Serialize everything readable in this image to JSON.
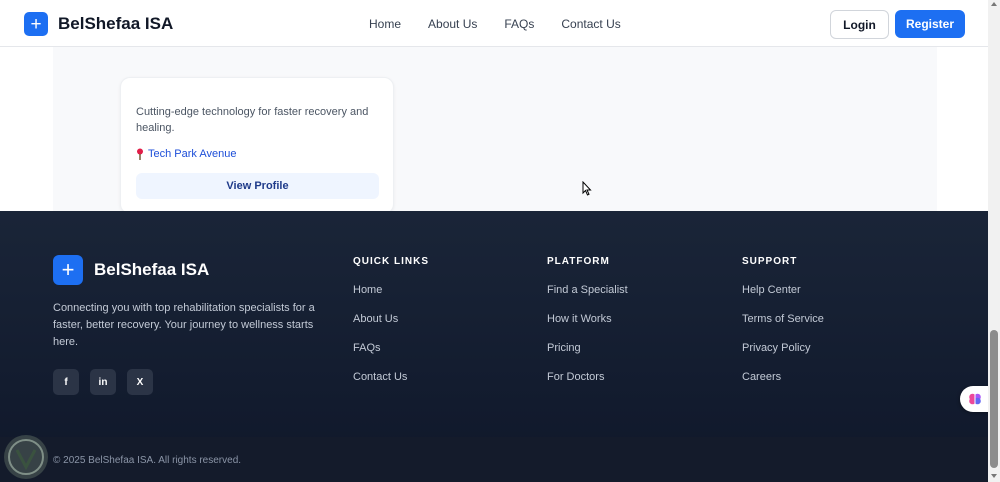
{
  "header": {
    "brand": "BelShefaa ISA",
    "logo_glyph": "+",
    "nav": [
      "Home",
      "About Us",
      "FAQs",
      "Contact Us"
    ],
    "login_label": "Login",
    "register_label": "Register"
  },
  "card": {
    "description": "Cutting-edge technology for faster recovery and healing.",
    "location": "Tech Park Avenue",
    "location_icon": "map-pin-icon",
    "button_label": "View Profile"
  },
  "footer": {
    "brand": "BelShefaa ISA",
    "logo_glyph": "+",
    "tagline": "Connecting you with top rehabilitation specialists for a faster, better recovery. Your journey to wellness starts here.",
    "socials": [
      {
        "label": "f",
        "icon": "facebook-icon"
      },
      {
        "label": "in",
        "icon": "linkedin-icon"
      },
      {
        "label": "X",
        "icon": "x-icon"
      }
    ],
    "columns": [
      {
        "title": "QUICK LINKS",
        "links": [
          "Home",
          "About Us",
          "FAQs",
          "Contact Us"
        ]
      },
      {
        "title": "PLATFORM",
        "links": [
          "Find a Specialist",
          "How it Works",
          "Pricing",
          "For Doctors"
        ]
      },
      {
        "title": "SUPPORT",
        "links": [
          "Help Center",
          "Terms of Service",
          "Privacy Policy",
          "Careers"
        ]
      }
    ],
    "copyright": "© 2025 BelShefaa ISA. All rights reserved."
  },
  "colors": {
    "primary": "#1d6ff2",
    "footer_bg": "#0f172a",
    "link_blue": "#1d4ed8"
  }
}
